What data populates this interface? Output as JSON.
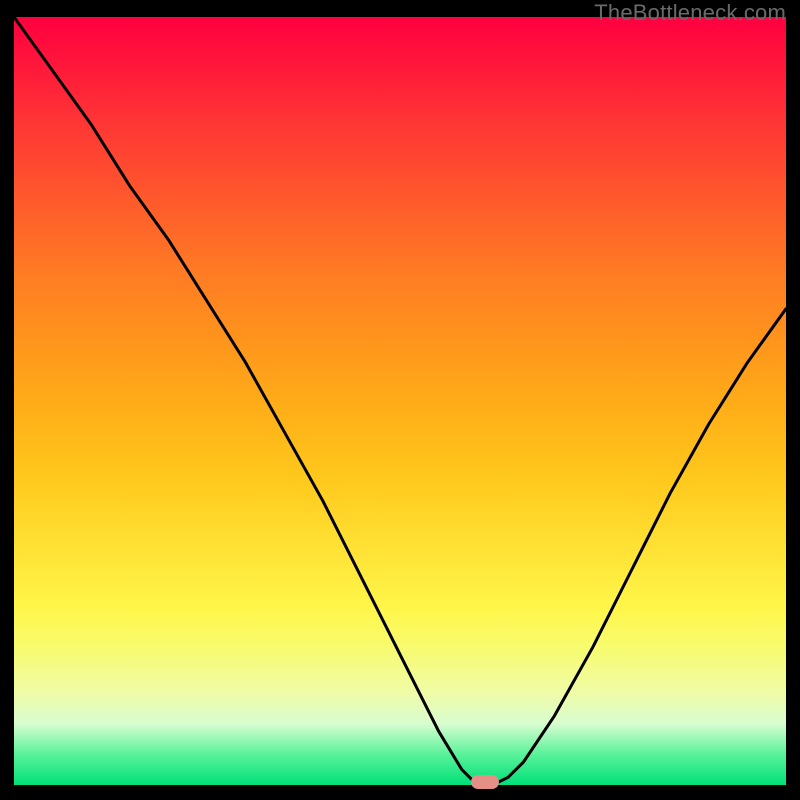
{
  "watermark": "TheBottleneck.com",
  "colors": {
    "curve_stroke": "#000000",
    "marker_fill": "#e58f86",
    "background": "#000000"
  },
  "chart_data": {
    "type": "line",
    "title": "",
    "xlabel": "",
    "ylabel": "",
    "xlim": [
      0,
      100
    ],
    "ylim": [
      0,
      100
    ],
    "grid": false,
    "legend": false,
    "series": [
      {
        "name": "bottleneck-curve",
        "x": [
          0,
          5,
          10,
          15,
          20,
          25,
          30,
          35,
          40,
          45,
          50,
          55,
          58,
          60,
          62,
          64,
          66,
          70,
          75,
          80,
          85,
          90,
          95,
          100
        ],
        "values": [
          100,
          93,
          86,
          78,
          71,
          63,
          55,
          46,
          37,
          27,
          17,
          7,
          2,
          0,
          0,
          1,
          3,
          9,
          18,
          28,
          38,
          47,
          55,
          62
        ]
      }
    ],
    "annotations": [
      {
        "name": "minimum-marker",
        "x": 61,
        "y": 0
      }
    ],
    "gradient_stops": [
      {
        "pos": 0.0,
        "color": "#ff0040"
      },
      {
        "pos": 0.5,
        "color": "#ffc81c"
      },
      {
        "pos": 0.8,
        "color": "#fff64a"
      },
      {
        "pos": 1.0,
        "color": "#00e079"
      }
    ]
  }
}
